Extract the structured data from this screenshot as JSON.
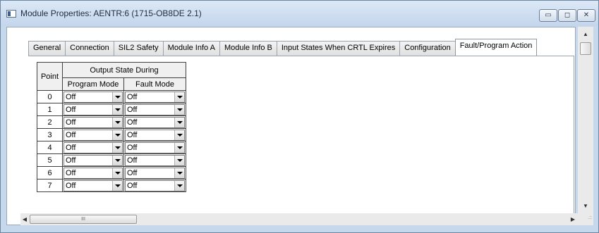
{
  "window": {
    "title": "Module Properties: AENTR:6 (1715-OB8DE 2.1)",
    "buttons": {
      "minimize": "▭",
      "maximize": "◻",
      "close": "✕"
    }
  },
  "tabs": [
    {
      "label": "General",
      "active": false
    },
    {
      "label": "Connection",
      "active": false
    },
    {
      "label": "SIL2 Safety",
      "active": false
    },
    {
      "label": "Module Info A",
      "active": false
    },
    {
      "label": "Module Info B",
      "active": false
    },
    {
      "label": "Input States When CRTL Expires",
      "active": false
    },
    {
      "label": "Configuration",
      "active": false
    },
    {
      "label": "Fault/Program Action",
      "active": true
    }
  ],
  "grid": {
    "point_header": "Point",
    "group_header": "Output State During",
    "program_header": "Program Mode",
    "fault_header": "Fault Mode",
    "rows": [
      {
        "point": "0",
        "program": "Off",
        "fault": "Off"
      },
      {
        "point": "1",
        "program": "Off",
        "fault": "Off"
      },
      {
        "point": "2",
        "program": "Off",
        "fault": "Off"
      },
      {
        "point": "3",
        "program": "Off",
        "fault": "Off"
      },
      {
        "point": "4",
        "program": "Off",
        "fault": "Off"
      },
      {
        "point": "5",
        "program": "Off",
        "fault": "Off"
      },
      {
        "point": "6",
        "program": "Off",
        "fault": "Off"
      },
      {
        "point": "7",
        "program": "Off",
        "fault": "Off"
      }
    ]
  },
  "scrollbars": {
    "up": "▲",
    "down": "▼",
    "left": "◀",
    "right": "▶",
    "thumb_grip": "III",
    "size_grip": ".::"
  }
}
